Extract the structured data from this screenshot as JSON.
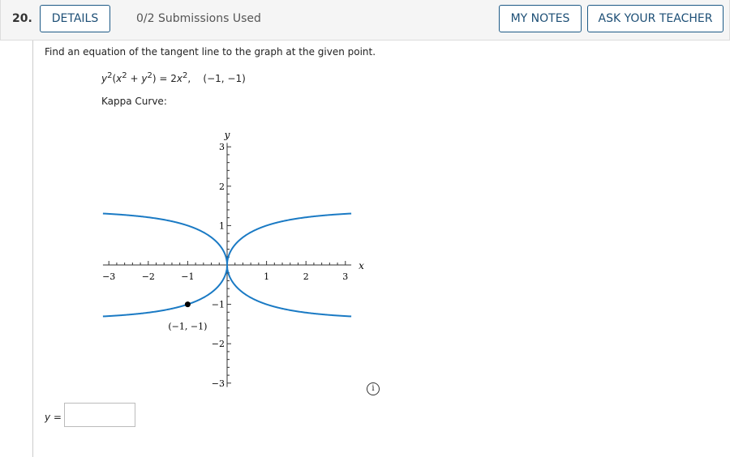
{
  "header": {
    "number": "20.",
    "details_label": "DETAILS",
    "submissions": "0/2 Submissions Used",
    "my_notes_label": "MY NOTES",
    "ask_teacher_label": "ASK YOUR TEACHER"
  },
  "question": {
    "prompt": "Find an equation of the tangent line to the graph at the given point.",
    "point": "(−1, −1)",
    "curve_label": "Kappa Curve:"
  },
  "answer": {
    "label": "y =",
    "value": ""
  },
  "chart_data": {
    "type": "line",
    "equation": "y^2(x^2 + y^2) = 2x^2",
    "xlabel": "x",
    "ylabel": "y",
    "xlim": [
      -3.15,
      3.15
    ],
    "ylim": [
      -3.1,
      3.1
    ],
    "xticks": [
      "−3",
      "−2",
      "−1",
      "1",
      "2",
      "3"
    ],
    "yticks": [
      "3",
      "2",
      "1",
      "−1",
      "−2",
      "−3"
    ],
    "curve_color": "#1a7ac4",
    "marked_point": {
      "x": -1,
      "y": -1,
      "label": "(−1, −1)"
    }
  },
  "info_icon": "info-circle-icon"
}
